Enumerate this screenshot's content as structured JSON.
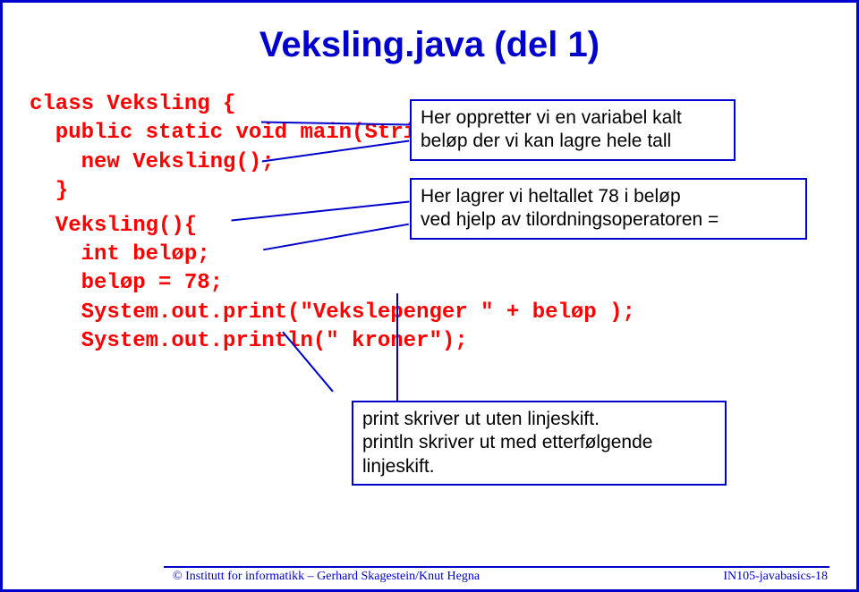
{
  "title": "Veksling.java (del 1)",
  "code": {
    "l1": "class Veksling {",
    "l2": "  public static void main(String[ ] args) {",
    "l3": "    new Veksling();",
    "l4": "  }",
    "l5": "  Veksling(){",
    "l6": "    int beløp;",
    "l7": "    beløp = 78;",
    "l8": "    System.out.print(\"Vekslepenger \" + beløp );",
    "l9": "    System.out.println(\" kroner\");"
  },
  "callouts": {
    "c1a": "Her oppretter vi en variabel kalt",
    "c1b": "beløp der vi kan lagre hele tall",
    "c2a": "Her lagrer vi heltallet 78 i beløp",
    "c2b": "ved hjelp av tilordningsoperatoren =",
    "c3a": "print skriver ut uten linjeskift.",
    "c3b": "println skriver ut med etterfølgende",
    "c3c": "linjeskift."
  },
  "footer": {
    "left": "©  Institutt for informatikk – Gerhard Skagestein/Knut Hegna",
    "right": "IN105-javabasics-18"
  }
}
